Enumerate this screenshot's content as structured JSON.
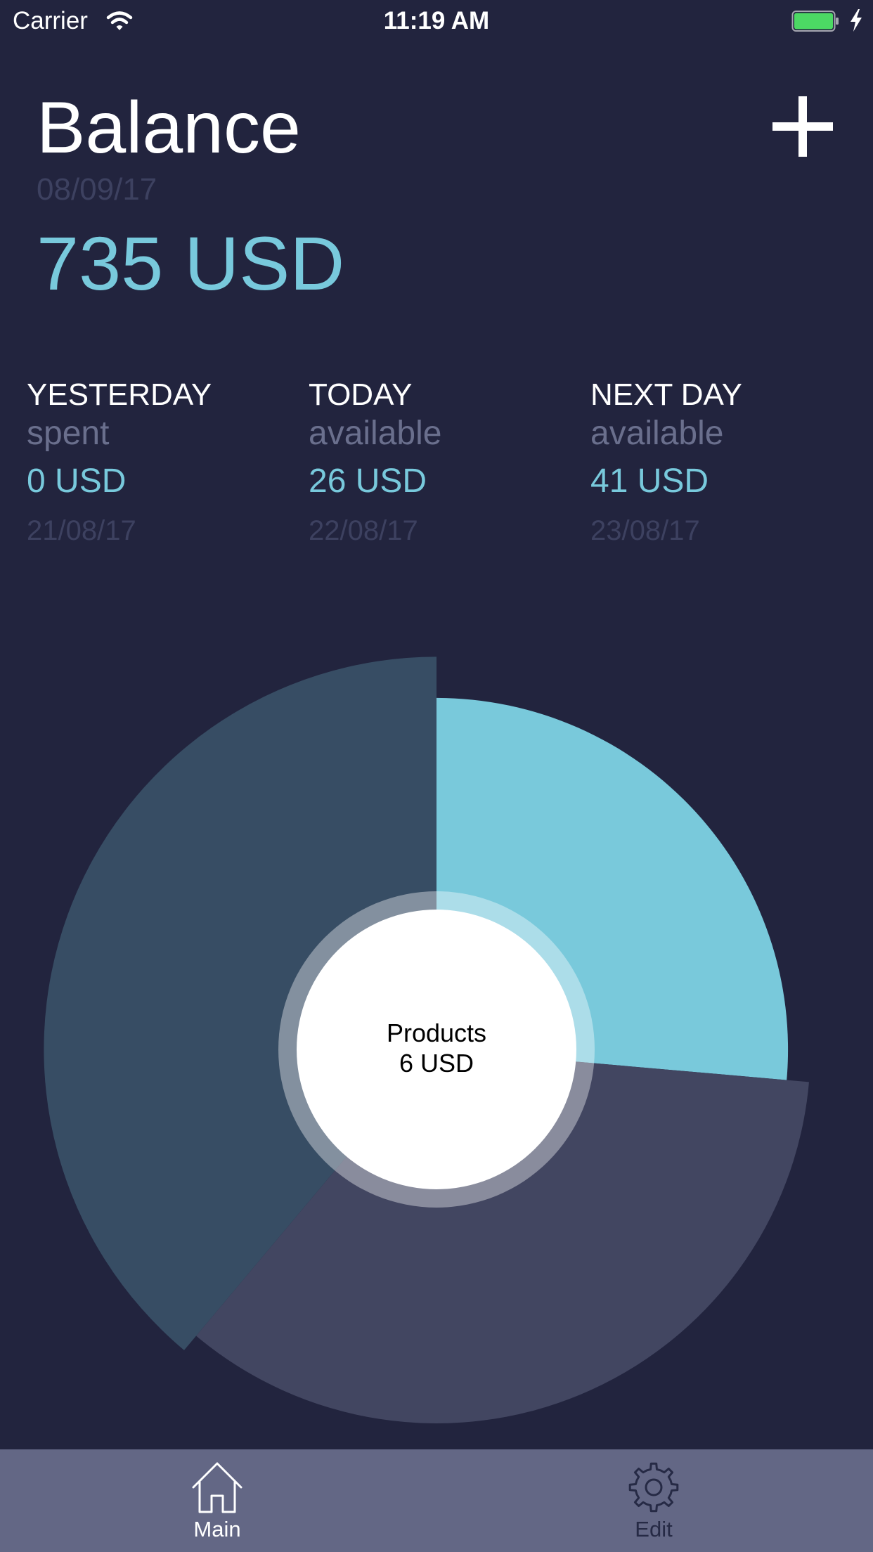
{
  "status_bar": {
    "carrier": "Carrier",
    "time": "11:19 AM",
    "icons": [
      "wifi-icon",
      "battery-icon",
      "charging-bolt-icon"
    ],
    "battery_color": "#4cd964"
  },
  "header": {
    "title": "Balance",
    "date": "08/09/17",
    "amount": "735 USD",
    "add_icon": "plus-icon"
  },
  "days": [
    {
      "title": "YESTERDAY",
      "subtitle": "spent",
      "amount": "0 USD",
      "date": "21/08/17"
    },
    {
      "title": "TODAY",
      "subtitle": "available",
      "amount": "26 USD",
      "date": "22/08/17"
    },
    {
      "title": "NEXT DAY",
      "subtitle": "available",
      "amount": "41 USD",
      "date": "23/08/17"
    }
  ],
  "chart_data": {
    "type": "pie",
    "center_label": {
      "category": "Products",
      "amount": "6 USD"
    },
    "slices": [
      {
        "angle_deg": 95,
        "radius_fraction": 0.94,
        "color": "#79c9db"
      },
      {
        "angle_deg": 125,
        "radius_fraction": 1.0,
        "color": "#424661"
      },
      {
        "angle_deg": 140,
        "radius_fraction": 1.05,
        "color": "#374d64"
      }
    ]
  },
  "colors": {
    "background": "#22243e",
    "accent": "#78c9dc",
    "muted_text": "#6a6f8d",
    "dim_text": "#3d4160",
    "tab_bar": "#636785"
  },
  "tab_bar": {
    "tabs": [
      {
        "label": "Main",
        "icon": "home-icon",
        "active": true
      },
      {
        "label": "Edit",
        "icon": "gear-icon",
        "active": false
      }
    ]
  }
}
